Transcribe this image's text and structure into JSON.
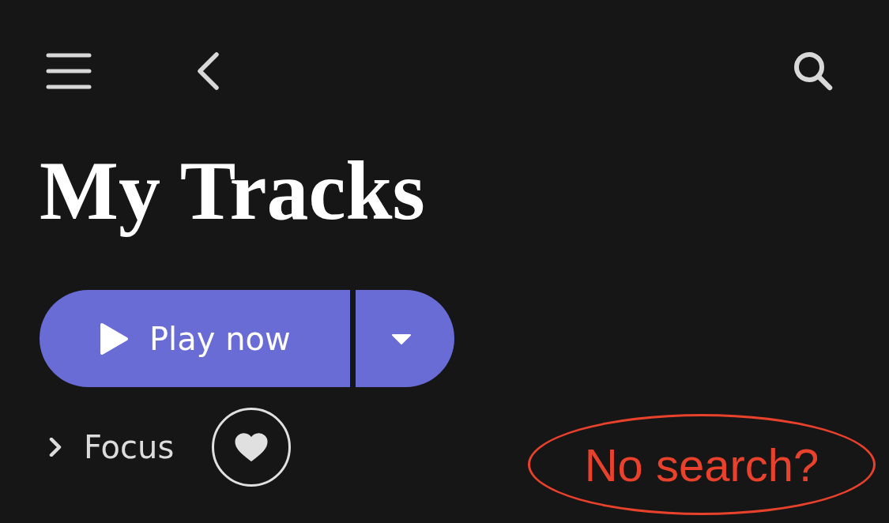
{
  "title": "My Tracks",
  "play_button": {
    "label": "Play now"
  },
  "focus": {
    "label": "Focus",
    "expanded": false,
    "favorited": true
  },
  "annotation": {
    "text": "No search?",
    "color": "#e8412c"
  }
}
